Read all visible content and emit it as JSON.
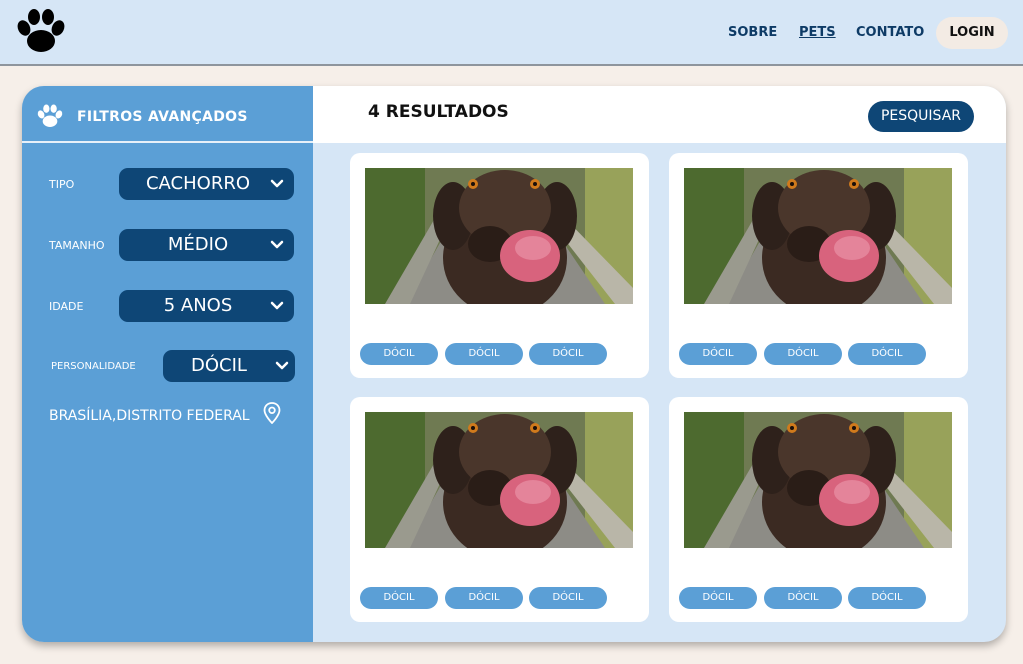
{
  "header": {
    "logo_icon": "paw-icon",
    "nav": [
      {
        "label": "SOBRE",
        "active": false
      },
      {
        "label": "PETS",
        "active": true
      },
      {
        "label": "CONTATO",
        "active": false
      }
    ],
    "login_label": "LOGIN"
  },
  "sidebar": {
    "title": "FILTROS AVANÇADOS",
    "title_icon": "paw-icon",
    "filters": [
      {
        "label": "TIPO",
        "value": "CACHORRO"
      },
      {
        "label": "TAMANHO",
        "value": "MÉDIO"
      },
      {
        "label": "IDADE",
        "value": "5 ANOS"
      },
      {
        "label": "PERSONALIDADE",
        "value": "DÓCIL"
      }
    ],
    "location": "BRASÍLIA,DISTRITO FEDERAL",
    "location_icon": "map-pin-icon"
  },
  "results": {
    "count_label": "4 RESULTADOS",
    "search_label": "PESQUISAR",
    "cards": [
      {
        "tags": [
          "DÓCIL",
          "DÓCIL",
          "DÓCIL"
        ]
      },
      {
        "tags": [
          "DÓCIL",
          "DÓCIL",
          "DÓCIL"
        ]
      },
      {
        "tags": [
          "DÓCIL",
          "DÓCIL",
          "DÓCIL"
        ]
      },
      {
        "tags": [
          "DÓCIL",
          "DÓCIL",
          "DÓCIL"
        ]
      }
    ]
  },
  "colors": {
    "header_bg": "#d6e6f6",
    "sidebar_bg": "#5b9fd6",
    "accent_dark": "#0e4676",
    "tag_bg": "#5b9fd6",
    "page_bg": "#f6efe9"
  }
}
